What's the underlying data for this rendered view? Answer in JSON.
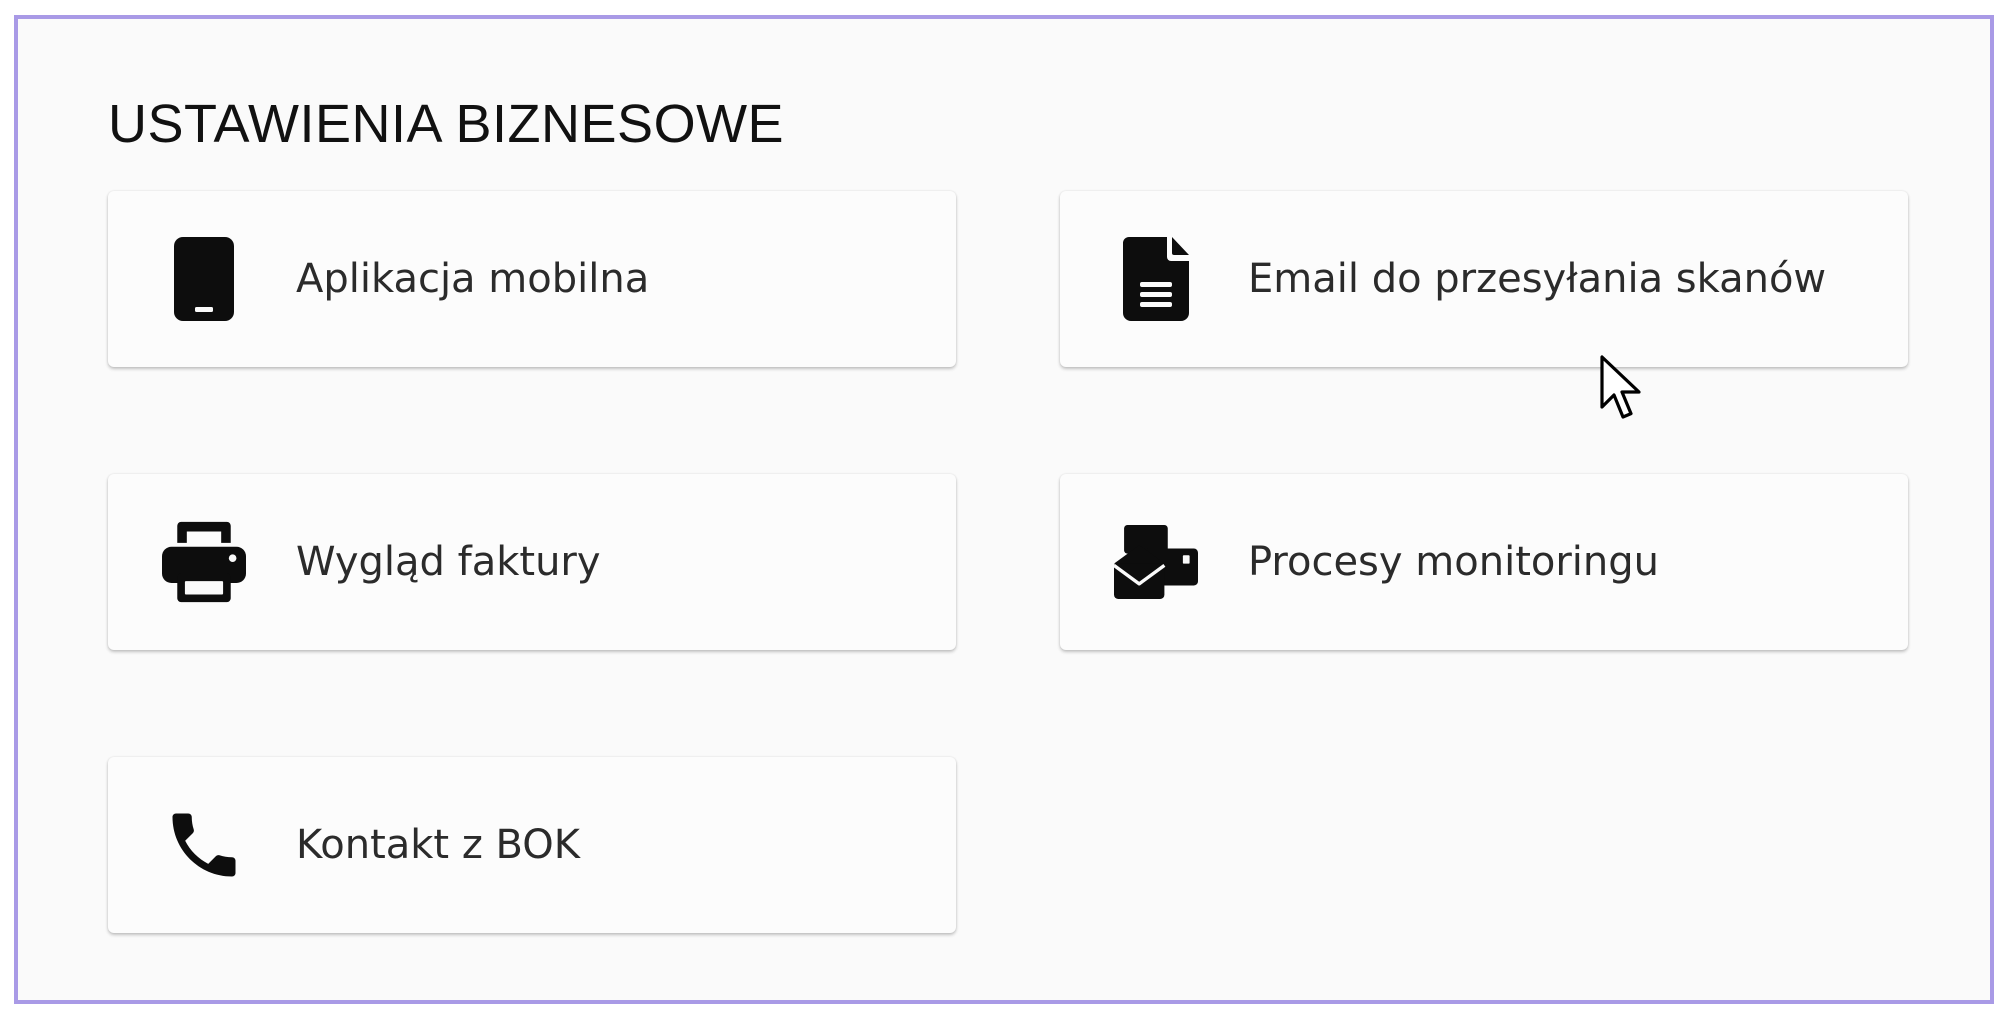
{
  "section": {
    "title": "USTAWIENIA BIZNESOWE"
  },
  "cards": [
    {
      "label": "Aplikacja mobilna",
      "icon": "mobile-phone-icon"
    },
    {
      "label": "Email do przesyłania skanów",
      "icon": "document-icon"
    },
    {
      "label": "Wygląd faktury",
      "icon": "printer-icon"
    },
    {
      "label": "Procesy monitoringu",
      "icon": "envelopes-icon"
    },
    {
      "label": "Kontakt z BOK",
      "icon": "phone-icon"
    }
  ],
  "colors": {
    "frame_border": "#a99ae6",
    "background": "#fafafa",
    "card_background": "#fcfcfc",
    "icon": "#0d0d0d",
    "text": "#2b2b2b"
  }
}
